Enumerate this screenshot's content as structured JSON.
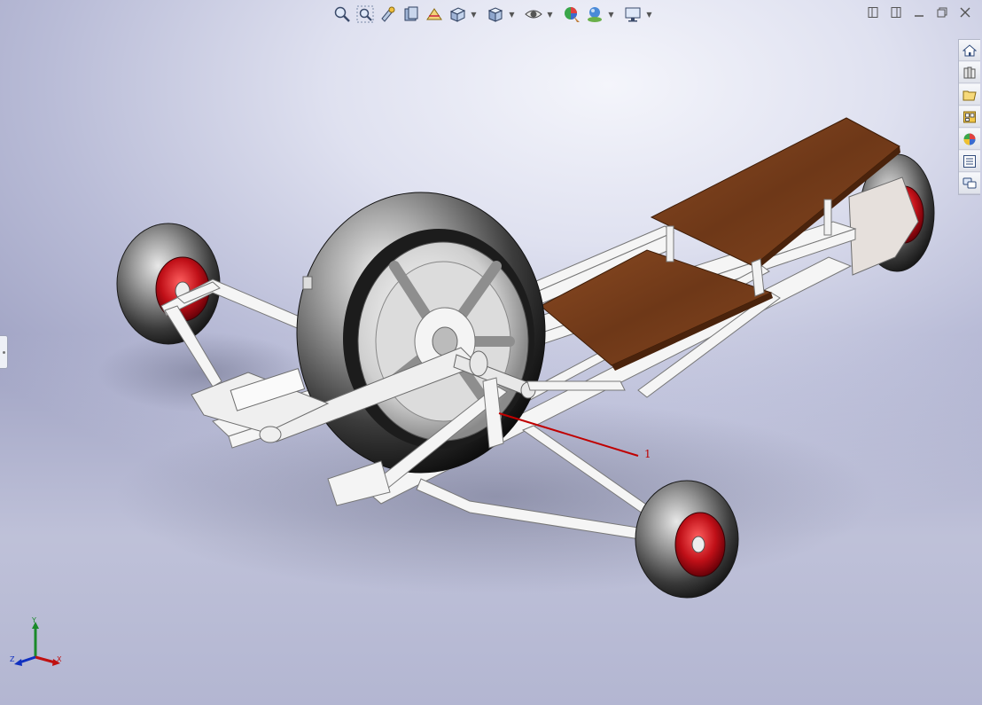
{
  "window": {
    "title": ""
  },
  "hud_toolbar": {
    "tools": [
      {
        "name": "zoom-to-fit-icon"
      },
      {
        "name": "zoom-to-area-icon"
      },
      {
        "name": "previous-view-icon"
      },
      {
        "name": "section-view-icon"
      },
      {
        "name": "dynamic-annotation-views-icon"
      },
      {
        "name": "view-orientation-icon",
        "dropdown": true
      },
      {
        "name": "display-style-icon",
        "dropdown": true
      },
      {
        "name": "hide-show-items-icon",
        "dropdown": true
      },
      {
        "name": "edit-appearance-icon"
      },
      {
        "name": "apply-scene-icon",
        "dropdown": true
      },
      {
        "name": "view-settings-icon",
        "dropdown": true
      }
    ]
  },
  "task_pane": {
    "tabs": [
      "home-icon",
      "design-library-icon",
      "file-explorer-icon",
      "view-palette-icon",
      "appearances-icon",
      "custom-properties-icon",
      "forum-icon"
    ]
  },
  "model": {
    "balloon_number": "1",
    "colors": {
      "frame": "#f4f4f4",
      "frame_edge": "#7a7a7a",
      "tire": "#3a3a3a",
      "rim": "#c01018",
      "deck": "#7a3e1c",
      "balloon": "#c00000"
    }
  },
  "triad": {
    "x_label": "X",
    "y_label": "Y",
    "z_label": "Z"
  }
}
